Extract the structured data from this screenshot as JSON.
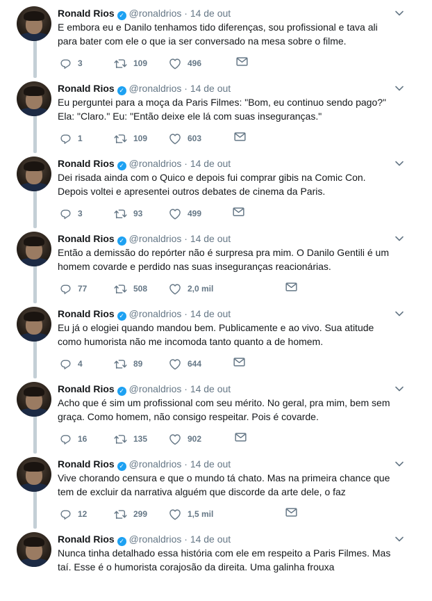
{
  "tweets": [
    {
      "name": "Ronald Rios",
      "handle": "@ronaldrios",
      "separator": "·",
      "date": "14 de out",
      "text": "E embora eu e Danilo tenhamos tido diferenças, sou profissional e tava ali para bater com ele o que ia ser conversado na mesa sobre o filme.",
      "replies": "3",
      "retweets": "109",
      "likes": "496"
    },
    {
      "name": "Ronald Rios",
      "handle": "@ronaldrios",
      "separator": "·",
      "date": "14 de out",
      "text": "Eu perguntei para a moça da Paris Filmes: \"Bom, eu continuo sendo pago?\" Ela: \"Claro.\" Eu: \"Então deixe ele lá com suas inseguranças.\"",
      "replies": "1",
      "retweets": "109",
      "likes": "603"
    },
    {
      "name": "Ronald Rios",
      "handle": "@ronaldrios",
      "separator": "·",
      "date": "14 de out",
      "text": "Dei risada ainda com o Quico e depois fui comprar gibis na Comic Con. Depois voltei e apresentei outros debates de cinema da Paris.",
      "replies": "3",
      "retweets": "93",
      "likes": "499"
    },
    {
      "name": "Ronald Rios",
      "handle": "@ronaldrios",
      "separator": "·",
      "date": "14 de out",
      "text": "Então a demissão do repórter não é surpresa pra mim. O Danilo Gentili é um homem covarde e perdido nas suas inseguranças reacionárias.",
      "replies": "77",
      "retweets": "508",
      "likes": "2,0 mil"
    },
    {
      "name": "Ronald Rios",
      "handle": "@ronaldrios",
      "separator": "·",
      "date": "14 de out",
      "text": "Eu já o elogiei quando mandou bem. Publicamente e ao vivo. Sua atitude como humorista não me incomoda tanto quanto a de homem.",
      "replies": "4",
      "retweets": "89",
      "likes": "644"
    },
    {
      "name": "Ronald Rios",
      "handle": "@ronaldrios",
      "separator": "·",
      "date": "14 de out",
      "text": "Acho que é sim um profissional com seu mérito. No geral, pra mim, bem sem graça. Como homem, não consigo respeitar. Pois é covarde.",
      "replies": "16",
      "retweets": "135",
      "likes": "902"
    },
    {
      "name": "Ronald Rios",
      "handle": "@ronaldrios",
      "separator": "·",
      "date": "14 de out",
      "text": "Vive chorando censura e que o mundo tá chato. Mas na primeira chance que tem de excluir da narrativa alguém que discorde da arte dele, o faz",
      "replies": "12",
      "retweets": "299",
      "likes": "1,5 mil"
    },
    {
      "name": "Ronald Rios",
      "handle": "@ronaldrios",
      "separator": "·",
      "date": "14 de out",
      "text": "Nunca tinha detalhado essa história com ele em respeito a Paris Filmes. Mas taí. Esse é o humorista corajosão da direita. Uma galinha frouxa",
      "replies": "",
      "retweets": "",
      "likes": ""
    }
  ],
  "icons": {
    "reply": "reply-icon",
    "retweet": "retweet-icon",
    "like": "heart-icon",
    "dm": "envelope-icon",
    "caret": "chevron-down-icon",
    "verified": "verified-badge-icon"
  },
  "colors": {
    "thread_line": "#c4cfd6",
    "verified": "#1da1f2",
    "muted": "#657786",
    "text": "#14171a"
  }
}
